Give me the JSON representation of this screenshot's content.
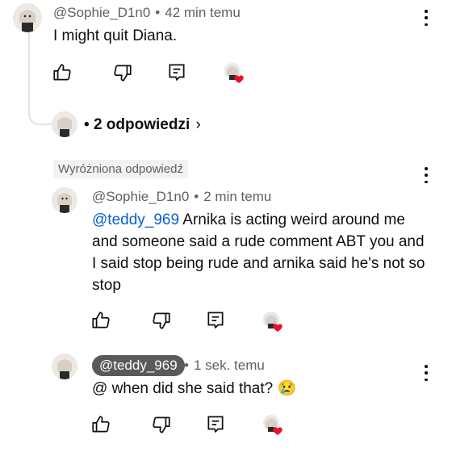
{
  "top_comment": {
    "author": "@Sophie_D1n0",
    "time": "42 min temu",
    "text": "I might quit Diana."
  },
  "replies_toggle": {
    "bullet": "•",
    "label": "2 odpowiedzi",
    "chevron": "›"
  },
  "highlight_badge": "Wyróżniona odpowiedź",
  "reply1": {
    "author": "@Sophie_D1n0",
    "time": "2 min temu",
    "mention": "@teddy_969",
    "text": " Arnika is acting weird around me and someone said a rude comment ABT you and I said stop being rude and arnika said he's not so stop"
  },
  "reply2": {
    "author": "@teddy_969",
    "time": "1 sek. temu",
    "text": "@ when did she said that? 😢"
  },
  "separator": "•",
  "icons": {
    "like": "thumb-up-icon",
    "dislike": "thumb-down-icon",
    "reply": "reply-icon",
    "menu": "more-vert-icon",
    "heart": "heart-icon"
  },
  "colors": {
    "mention": "#065fd4",
    "heart": "#e8102d",
    "meta": "#606060"
  }
}
